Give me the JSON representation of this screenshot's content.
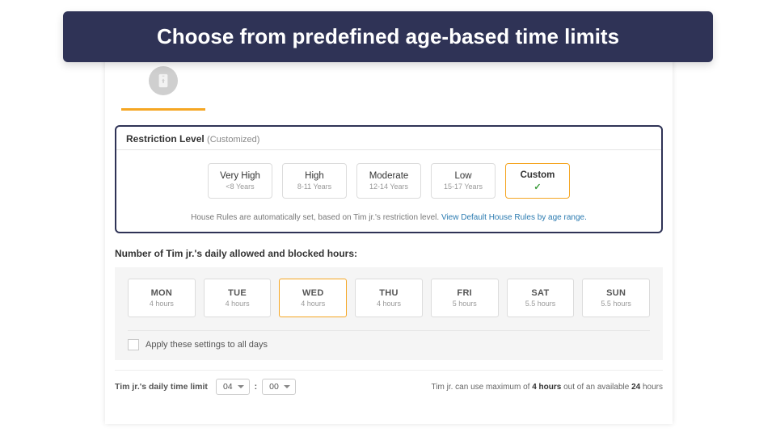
{
  "banner": "Choose from predefined age-based time limits",
  "tab_icon": "phone-icon",
  "restriction": {
    "label": "Restriction Level",
    "suffix": "(Customized)",
    "levels": [
      {
        "name": "Very High",
        "sub": "<8 Years",
        "selected": false
      },
      {
        "name": "High",
        "sub": "8-11 Years",
        "selected": false
      },
      {
        "name": "Moderate",
        "sub": "12-14 Years",
        "selected": false
      },
      {
        "name": "Low",
        "sub": "15-17 Years",
        "selected": false
      },
      {
        "name": "Custom",
        "sub": "",
        "selected": true
      }
    ],
    "house_rules_text": "House Rules are automatically set, based on Tim jr.'s restriction level. ",
    "house_rules_link": "View Default House Rules by age range."
  },
  "daily": {
    "title": "Number of Tim jr.'s daily allowed and blocked hours:",
    "days": [
      {
        "name": "MON",
        "hours": "4 hours",
        "selected": false
      },
      {
        "name": "TUE",
        "hours": "4 hours",
        "selected": false
      },
      {
        "name": "WED",
        "hours": "4 hours",
        "selected": true
      },
      {
        "name": "THU",
        "hours": "4 hours",
        "selected": false
      },
      {
        "name": "FRI",
        "hours": "5 hours",
        "selected": false
      },
      {
        "name": "SAT",
        "hours": "5.5 hours",
        "selected": false
      },
      {
        "name": "SUN",
        "hours": "5.5 hours",
        "selected": false
      }
    ],
    "apply_all": "Apply these settings to all days"
  },
  "limit": {
    "label": "Tim jr.'s daily time limit",
    "hours": "04",
    "minutes": "00",
    "info_prefix": "Tim jr. can use maximum of ",
    "info_max": "4 hours",
    "info_mid": " out of an available ",
    "info_total": "24",
    "info_suffix": " hours"
  }
}
